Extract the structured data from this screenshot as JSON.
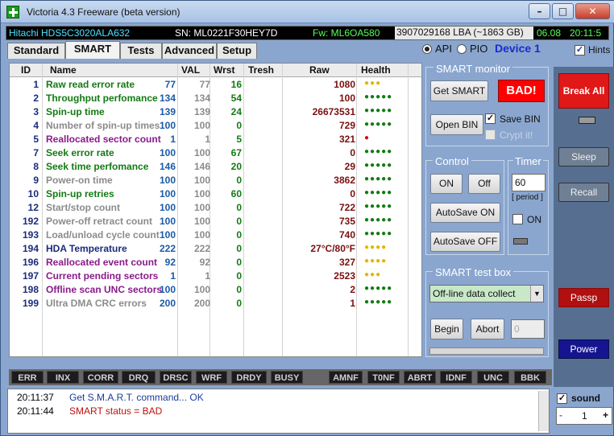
{
  "window": {
    "title": "Victoria 4.3 Freeware (beta version)"
  },
  "infobar": {
    "model": "Hitachi HDS5C3020ALA632",
    "serial": "SN: ML0221F30HEY7D",
    "firmware": "Fw: ML6OA580",
    "lba": "3907029168 LBA (~1863 GB)",
    "date": "06.08",
    "time": "20:11:5"
  },
  "tabs": [
    {
      "label": "Standard"
    },
    {
      "label": "SMART"
    },
    {
      "label": "Tests"
    },
    {
      "label": "Advanced"
    },
    {
      "label": "Setup"
    }
  ],
  "mode": {
    "api": "API",
    "pio": "PIO",
    "device": "Device 1",
    "hints": "Hints"
  },
  "table": {
    "headers": [
      "ID",
      "Name",
      "VAL",
      "Wrst",
      "Tresh",
      "Raw",
      "Health"
    ],
    "rows": [
      {
        "id": "1",
        "name": "Raw read error rate",
        "val": "77",
        "wrst": "77",
        "tresh": "16",
        "raw": "1080",
        "health": "●●●",
        "hcolor": "#e2b600",
        "ncolor": "#137a13"
      },
      {
        "id": "2",
        "name": "Throughput perfomance",
        "val": "134",
        "wrst": "134",
        "tresh": "54",
        "raw": "100",
        "health": "●●●●●",
        "hcolor": "#137a13",
        "ncolor": "#137a13"
      },
      {
        "id": "3",
        "name": "Spin-up time",
        "val": "139",
        "wrst": "139",
        "tresh": "24",
        "raw": "26673531",
        "health": "●●●●●",
        "hcolor": "#137a13",
        "ncolor": "#137a13"
      },
      {
        "id": "4",
        "name": "Number of spin-up times",
        "val": "100",
        "wrst": "100",
        "tresh": "0",
        "raw": "729",
        "health": "●●●●●",
        "hcolor": "#137a13",
        "ncolor": "#8b8b8b"
      },
      {
        "id": "5",
        "name": "Reallocated sector count",
        "val": "1",
        "wrst": "1",
        "tresh": "5",
        "raw": "321",
        "health": "●",
        "hcolor": "#d01010",
        "ncolor": "#8a1a8a"
      },
      {
        "id": "7",
        "name": "Seek error rate",
        "val": "100",
        "wrst": "100",
        "tresh": "67",
        "raw": "0",
        "health": "●●●●●",
        "hcolor": "#137a13",
        "ncolor": "#137a13"
      },
      {
        "id": "8",
        "name": "Seek time perfomance",
        "val": "146",
        "wrst": "146",
        "tresh": "20",
        "raw": "29",
        "health": "●●●●●",
        "hcolor": "#137a13",
        "ncolor": "#137a13"
      },
      {
        "id": "9",
        "name": "Power-on time",
        "val": "100",
        "wrst": "100",
        "tresh": "0",
        "raw": "3862",
        "health": "●●●●●",
        "hcolor": "#137a13",
        "ncolor": "#8b8b8b"
      },
      {
        "id": "10",
        "name": "Spin-up retries",
        "val": "100",
        "wrst": "100",
        "tresh": "60",
        "raw": "0",
        "health": "●●●●●",
        "hcolor": "#137a13",
        "ncolor": "#137a13"
      },
      {
        "id": "12",
        "name": "Start/stop count",
        "val": "100",
        "wrst": "100",
        "tresh": "0",
        "raw": "722",
        "health": "●●●●●",
        "hcolor": "#137a13",
        "ncolor": "#8b8b8b"
      },
      {
        "id": "192",
        "name": "Power-off retract count",
        "val": "100",
        "wrst": "100",
        "tresh": "0",
        "raw": "735",
        "health": "●●●●●",
        "hcolor": "#137a13",
        "ncolor": "#8b8b8b"
      },
      {
        "id": "193",
        "name": "Load/unload cycle count",
        "val": "100",
        "wrst": "100",
        "tresh": "0",
        "raw": "740",
        "health": "●●●●●",
        "hcolor": "#137a13",
        "ncolor": "#8b8b8b"
      },
      {
        "id": "194",
        "name": "HDA Temperature",
        "val": "222",
        "wrst": "222",
        "tresh": "0",
        "raw": "27°C/80°F",
        "health": "●●●●",
        "hcolor": "#e2b600",
        "ncolor": "#1b2b7a"
      },
      {
        "id": "196",
        "name": "Reallocated event count",
        "val": "92",
        "wrst": "92",
        "tresh": "0",
        "raw": "327",
        "health": "●●●●",
        "hcolor": "#e2b600",
        "ncolor": "#8a1a8a"
      },
      {
        "id": "197",
        "name": "Current pending sectors",
        "val": "1",
        "wrst": "1",
        "tresh": "0",
        "raw": "2523",
        "health": "●●●",
        "hcolor": "#e2b600",
        "ncolor": "#8a1a8a"
      },
      {
        "id": "198",
        "name": "Offline scan UNC sectors",
        "val": "100",
        "wrst": "100",
        "tresh": "0",
        "raw": "2",
        "health": "●●●●●",
        "hcolor": "#137a13",
        "ncolor": "#8a1a8a"
      },
      {
        "id": "199",
        "name": "Ultra DMA CRC errors",
        "val": "200",
        "wrst": "200",
        "tresh": "0",
        "raw": "1",
        "health": "●●●●●",
        "hcolor": "#137a13",
        "ncolor": "#8b8b8b"
      }
    ]
  },
  "smart_monitor": {
    "label": "SMART monitor",
    "get_smart": "Get SMART",
    "status": "BAD!",
    "open_bin": "Open BIN",
    "save_bin": "Save BIN",
    "crypt_it": "Crypt it!"
  },
  "control": {
    "label": "Control",
    "on": "ON",
    "off": "Off",
    "autosave_on": "AutoSave ON",
    "autosave_off": "AutoSave OFF"
  },
  "timer": {
    "label": "Timer",
    "value": "60",
    "period": "[ period ]",
    "on": "ON"
  },
  "test_box": {
    "label": "SMART test box",
    "selected": "Off-line data collect",
    "begin": "Begin",
    "abort": "Abort",
    "value": "0"
  },
  "right": {
    "break_all": "Break All",
    "sleep": "Sleep",
    "recall": "Recall",
    "passp": "Passp",
    "power": "Power",
    "sound": "sound",
    "counter": "1",
    "minus": "-",
    "plus": "+"
  },
  "status_flags": [
    "ERR",
    "INX",
    "CORR",
    "DRQ",
    "DRSC",
    "WRF",
    "DRDY",
    "BUSY",
    "AMNF",
    "T0NF",
    "ABRT",
    "IDNF",
    "UNC",
    "BBK"
  ],
  "log": [
    {
      "time": "20:11:37",
      "msg": "Get S.M.A.R.T. command... OK",
      "color": "#1a3c9c"
    },
    {
      "time": "20:11:44",
      "msg": "SMART status = BAD",
      "color": "#c01010"
    }
  ]
}
